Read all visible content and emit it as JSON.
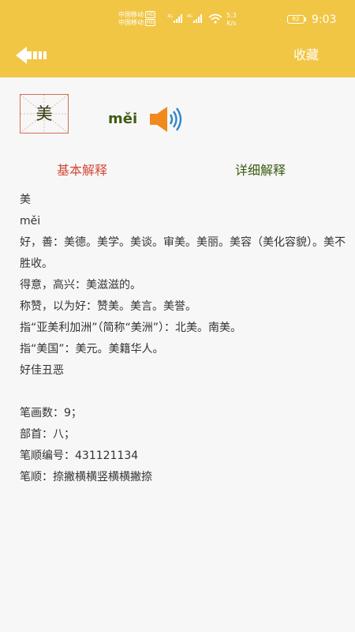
{
  "status_bar": {
    "carrier_1": "中国移动",
    "carrier_2": "中国移动",
    "hd_badge": "HD",
    "network_1": "4G",
    "network_2": "4G",
    "net_speed_value": "5.3",
    "net_speed_unit": "K/s",
    "battery": "62",
    "time": "9:03"
  },
  "header": {
    "back_icon": "back-arrow-icon",
    "favorite_label": "收藏"
  },
  "character": {
    "glyph": "美",
    "pinyin": "měi",
    "speaker_icon": "speaker-icon"
  },
  "tabs": {
    "basic": "基本解释",
    "detail": "详细解释"
  },
  "definition": {
    "head_char": "美",
    "head_pinyin": "měi",
    "lines": [
      "好，善：美德。美学。美谈。审美。美丽。美容（美化容貌）。美不胜收。",
      "得意，高兴：美滋滋的。",
      "称赞，以为好：赞美。美言。美誉。",
      "指“亚美利加洲”（简称“美洲”）：北美。南美。",
      "指“美国”：美元。美籍华人。",
      "好佳丑恶"
    ],
    "stroke_count": "笔画数：9；",
    "radical": "部首：八；",
    "stroke_code": "笔顺编号：431121134",
    "stroke_order": "笔顺：捺撇横横竖横横撇捺"
  },
  "colors": {
    "header_bg": "#f1c645",
    "tab_active": "#d24a38",
    "tab_inactive": "#3c5a10",
    "speaker": "#f08a1c"
  }
}
